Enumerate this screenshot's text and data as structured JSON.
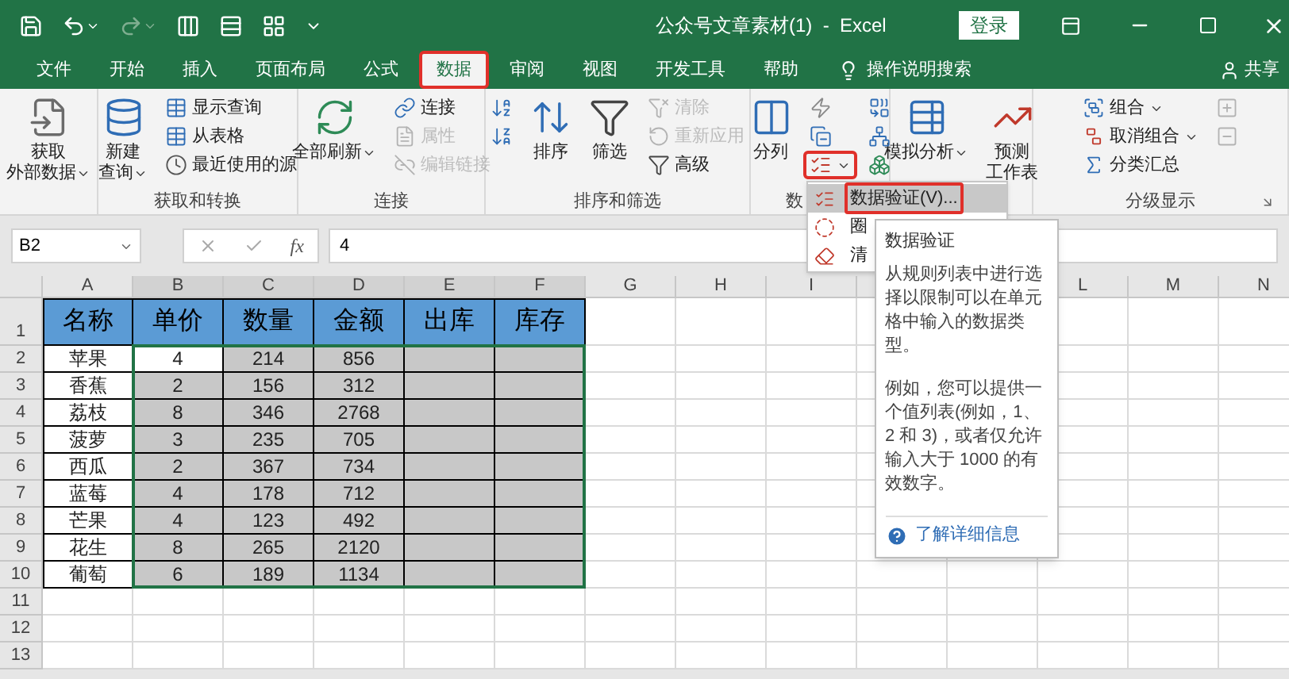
{
  "window": {
    "title": "公众号文章素材(1)  -  Excel",
    "sign_in": "登录"
  },
  "tabs": [
    {
      "label": "文件",
      "selected": false,
      "highlighted": false
    },
    {
      "label": "开始",
      "selected": false,
      "highlighted": false
    },
    {
      "label": "插入",
      "selected": false,
      "highlighted": false
    },
    {
      "label": "页面布局",
      "selected": false,
      "highlighted": false
    },
    {
      "label": "公式",
      "selected": false,
      "highlighted": false
    },
    {
      "label": "数据",
      "selected": true,
      "highlighted": true
    },
    {
      "label": "审阅",
      "selected": false,
      "highlighted": false
    },
    {
      "label": "视图",
      "selected": false,
      "highlighted": false
    },
    {
      "label": "开发工具",
      "selected": false,
      "highlighted": false
    },
    {
      "label": "帮助",
      "selected": false,
      "highlighted": false
    }
  ],
  "tell_me": "操作说明搜索",
  "share": "共享",
  "ribbon_groups": [
    {
      "columns": [
        {
          "kind": "large",
          "lines": [
            "获取",
            "外部数据"
          ],
          "dropdown": true
        }
      ]
    },
    {
      "label": "获取和转换",
      "columns": [
        {
          "kind": "large",
          "lines": [
            "新建",
            "查询"
          ],
          "dropdown": true
        },
        {
          "kind": "stack",
          "items": [
            {
              "label": "显示查询",
              "disabled": false
            },
            {
              "label": "从表格",
              "disabled": false
            },
            {
              "label": "最近使用的源",
              "disabled": false
            }
          ]
        }
      ]
    },
    {
      "label": "连接",
      "columns": [
        {
          "kind": "large",
          "lines": [
            "全部刷新"
          ],
          "dropdown": true
        },
        {
          "kind": "stack",
          "items": [
            {
              "label": "连接",
              "disabled": false
            },
            {
              "label": "属性",
              "disabled": true
            },
            {
              "label": "编辑链接",
              "disabled": true
            }
          ]
        }
      ]
    },
    {
      "label": "排序和筛选",
      "columns": [
        {
          "kind": "stack",
          "items": [
            {
              "disabled": false
            },
            {
              "disabled": false
            }
          ]
        },
        {
          "kind": "large",
          "lines": [
            "排序"
          ]
        },
        {
          "kind": "large",
          "lines": [
            "筛选"
          ]
        },
        {
          "kind": "stack",
          "items": [
            {
              "label": "清除",
              "disabled": true
            },
            {
              "label": "重新应用",
              "disabled": true
            },
            {
              "label": "高级",
              "disabled": false
            }
          ]
        }
      ]
    },
    {
      "label": "数",
      "columns": [
        {
          "kind": "large",
          "lines": [
            "分列"
          ]
        },
        {
          "kind": "stack",
          "items": [
            {
              "disabled": false
            },
            {
              "disabled": false
            },
            {
              "disabled": false,
              "dropdown": true,
              "highlighted": true,
              "menu_open": true
            }
          ]
        },
        {
          "kind": "stack",
          "items": [
            {
              "disabled": false
            },
            {
              "disabled": false
            },
            {
              "disabled": false
            }
          ]
        }
      ]
    },
    {
      "columns": [
        {
          "kind": "large",
          "lines": [
            "模拟分析"
          ],
          "dropdown": true
        },
        {
          "kind": "large",
          "lines": [
            "预测",
            "工作表"
          ]
        }
      ]
    },
    {
      "label": "分级显示",
      "launcher": true,
      "columns": [
        {
          "kind": "stack",
          "items": [
            {
              "label": "组合",
              "dropdown": true,
              "disabled": false
            },
            {
              "label": "取消组合",
              "dropdown": true,
              "disabled": false
            },
            {
              "label": "分类汇总",
              "disabled": false
            }
          ]
        },
        {
          "kind": "stack",
          "items": [
            {
              "disabled": true
            },
            {
              "disabled": true
            }
          ]
        }
      ]
    }
  ],
  "menu": {
    "items": [
      {
        "label": "数据验证(V)...",
        "selected": true,
        "highlighted": true
      },
      {
        "label": "圈",
        "selected": false,
        "highlighted": false
      },
      {
        "label": "清",
        "selected": false,
        "highlighted": false
      }
    ]
  },
  "tooltip": {
    "title": "数据验证",
    "paragraphs": [
      "从规则列表中进行选择以限制可以在单元格中输入的数据类型。",
      "例如，您可以提供一个值列表(例如，1、2 和 3)，或者仅允许输入大于 1000 的有效数字。"
    ],
    "link": "了解详细信息"
  },
  "formula_bar": {
    "name_box": "B2",
    "fx": "fx",
    "value": "4"
  },
  "column_headers": [
    {
      "label": "A",
      "selected": false
    },
    {
      "label": "B",
      "selected": true
    },
    {
      "label": "C",
      "selected": true
    },
    {
      "label": "D",
      "selected": true
    },
    {
      "label": "E",
      "selected": true
    },
    {
      "label": "F",
      "selected": true
    },
    {
      "label": "G",
      "selected": false
    },
    {
      "label": "H",
      "selected": false
    },
    {
      "label": "I",
      "selected": false
    }
  ],
  "column_headers_right": [
    {
      "label": "L",
      "selected": false
    },
    {
      "label": "M",
      "selected": false
    },
    {
      "label": "N",
      "selected": false
    }
  ],
  "row_numbers": [
    "1",
    "2",
    "3",
    "4",
    "5",
    "6",
    "7",
    "8",
    "9",
    "10",
    "11",
    "12",
    "13"
  ],
  "table": {
    "header": [
      "名称",
      "单价",
      "数量",
      "金额",
      "出库",
      "库存"
    ],
    "rows": [
      {
        "cells": [
          "苹果",
          "4",
          "214",
          "856"
        ],
        "selected": true,
        "active": true
      },
      {
        "cells": [
          "香蕉",
          "2",
          "156",
          "312"
        ],
        "selected": true,
        "active": false
      },
      {
        "cells": [
          "荔枝",
          "8",
          "346",
          "2768"
        ],
        "selected": true,
        "active": false
      },
      {
        "cells": [
          "菠萝",
          "3",
          "235",
          "705"
        ],
        "selected": true,
        "active": false
      },
      {
        "cells": [
          "西瓜",
          "2",
          "367",
          "734"
        ],
        "selected": true,
        "active": false
      },
      {
        "cells": [
          "蓝莓",
          "4",
          "178",
          "712"
        ],
        "selected": true,
        "active": false
      },
      {
        "cells": [
          "芒果",
          "4",
          "123",
          "492"
        ],
        "selected": true,
        "active": false
      },
      {
        "cells": [
          "花生",
          "8",
          "265",
          "2120"
        ],
        "selected": true,
        "active": false
      },
      {
        "cells": [
          "葡萄",
          "6",
          "189",
          "1134"
        ],
        "selected": true,
        "active": false
      }
    ]
  }
}
